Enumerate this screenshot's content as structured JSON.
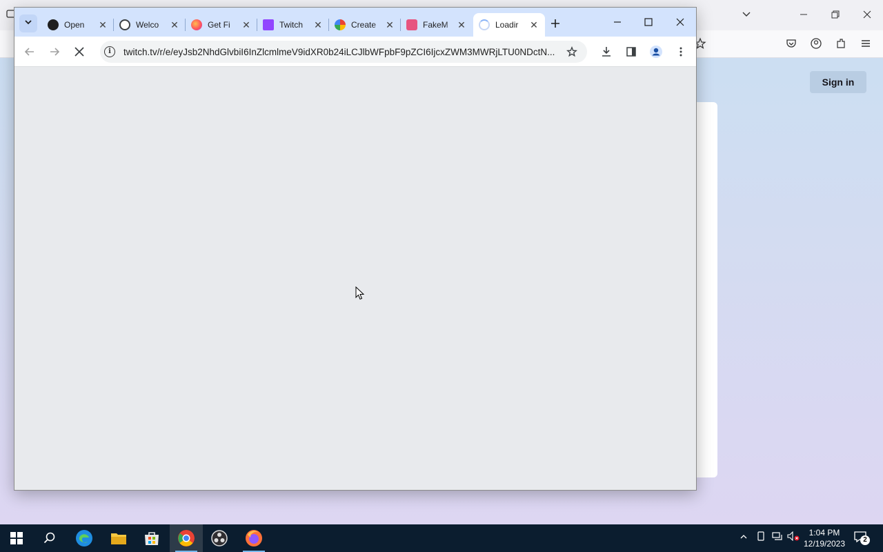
{
  "background_window": {
    "sign_in_label": "Sign in"
  },
  "chrome": {
    "tabs": [
      {
        "title": "Open",
        "favicon": "openai-icon",
        "active": false
      },
      {
        "title": "Welco",
        "favicon": "globe-icon",
        "active": false
      },
      {
        "title": "Get Fi",
        "favicon": "firefox-icon",
        "active": false
      },
      {
        "title": "Twitch",
        "favicon": "twitch-icon",
        "active": false
      },
      {
        "title": "Create",
        "favicon": "google-icon",
        "active": false
      },
      {
        "title": "FakeM",
        "favicon": "fakemail-icon",
        "active": false
      },
      {
        "title": "Loadir",
        "favicon": "loading-spinner-icon",
        "active": true
      }
    ],
    "url": "twitch.tv/r/e/eyJsb2NhdGlvbiI6InZlcmlmeV9idXR0b24iLCJlbWFpbF9pZCI6IjcxZWM3MWRjLTU0NDctN..."
  },
  "taskbar": {
    "time": "1:04 PM",
    "date": "12/19/2023",
    "notification_count": "2",
    "pinned_apps": [
      "windows-start-icon",
      "search-icon",
      "edge-icon",
      "file-explorer-icon",
      "microsoft-store-icon",
      "chrome-icon",
      "obs-icon",
      "firefox-icon"
    ]
  },
  "colors": {
    "tab_strip": "#d3e3fd",
    "toolbar": "#ffffff",
    "content_loading": "#e8eaed",
    "taskbar": "#0b1d2f",
    "sign_in_button": "#b9cde3"
  }
}
